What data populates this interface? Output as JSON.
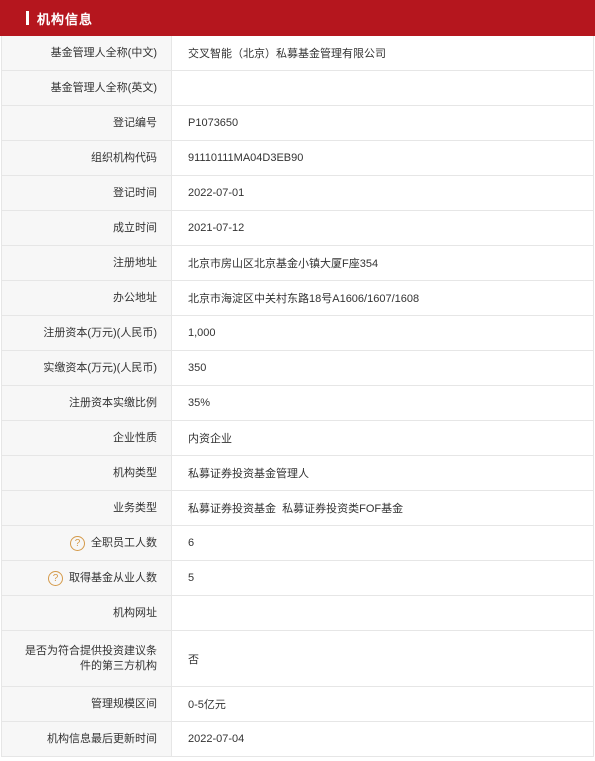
{
  "header": {
    "title": "机构信息"
  },
  "rows": [
    {
      "label": "基金管理人全称(中文)",
      "value": "交叉智能（北京）私募基金管理有限公司"
    },
    {
      "label": "基金管理人全称(英文)",
      "value": ""
    },
    {
      "label": "登记编号",
      "value": "P1073650"
    },
    {
      "label": "组织机构代码",
      "value": "91110111MA04D3EB90"
    },
    {
      "label": "登记时间",
      "value": "2022-07-01"
    },
    {
      "label": "成立时间",
      "value": "2021-07-12"
    },
    {
      "label": "注册地址",
      "value": "北京市房山区北京基金小镇大厦F座354"
    },
    {
      "label": "办公地址",
      "value": "北京市海淀区中关村东路18号A1606/1607/1608"
    },
    {
      "label": "注册资本(万元)(人民币)",
      "value": "1,000"
    },
    {
      "label": "实缴资本(万元)(人民币)",
      "value": "350"
    },
    {
      "label": "注册资本实缴比例",
      "value": "35%"
    },
    {
      "label": "企业性质",
      "value": "内资企业"
    },
    {
      "label": "机构类型",
      "value": "私募证券投资基金管理人"
    },
    {
      "label": "业务类型",
      "value": "私募证券投资基金  私募证券投资类FOF基金"
    },
    {
      "label": "全职员工人数",
      "value": "6",
      "help": "?"
    },
    {
      "label": "取得基金从业人数",
      "value": "5",
      "help": "?"
    },
    {
      "label": "机构网址",
      "value": ""
    },
    {
      "label": "是否为符合提供投资建议条件的第三方机构",
      "value": "否"
    },
    {
      "label": "管理规模区间",
      "value": "0-5亿元"
    },
    {
      "label": "机构信息最后更新时间",
      "value": "2022-07-04"
    }
  ]
}
